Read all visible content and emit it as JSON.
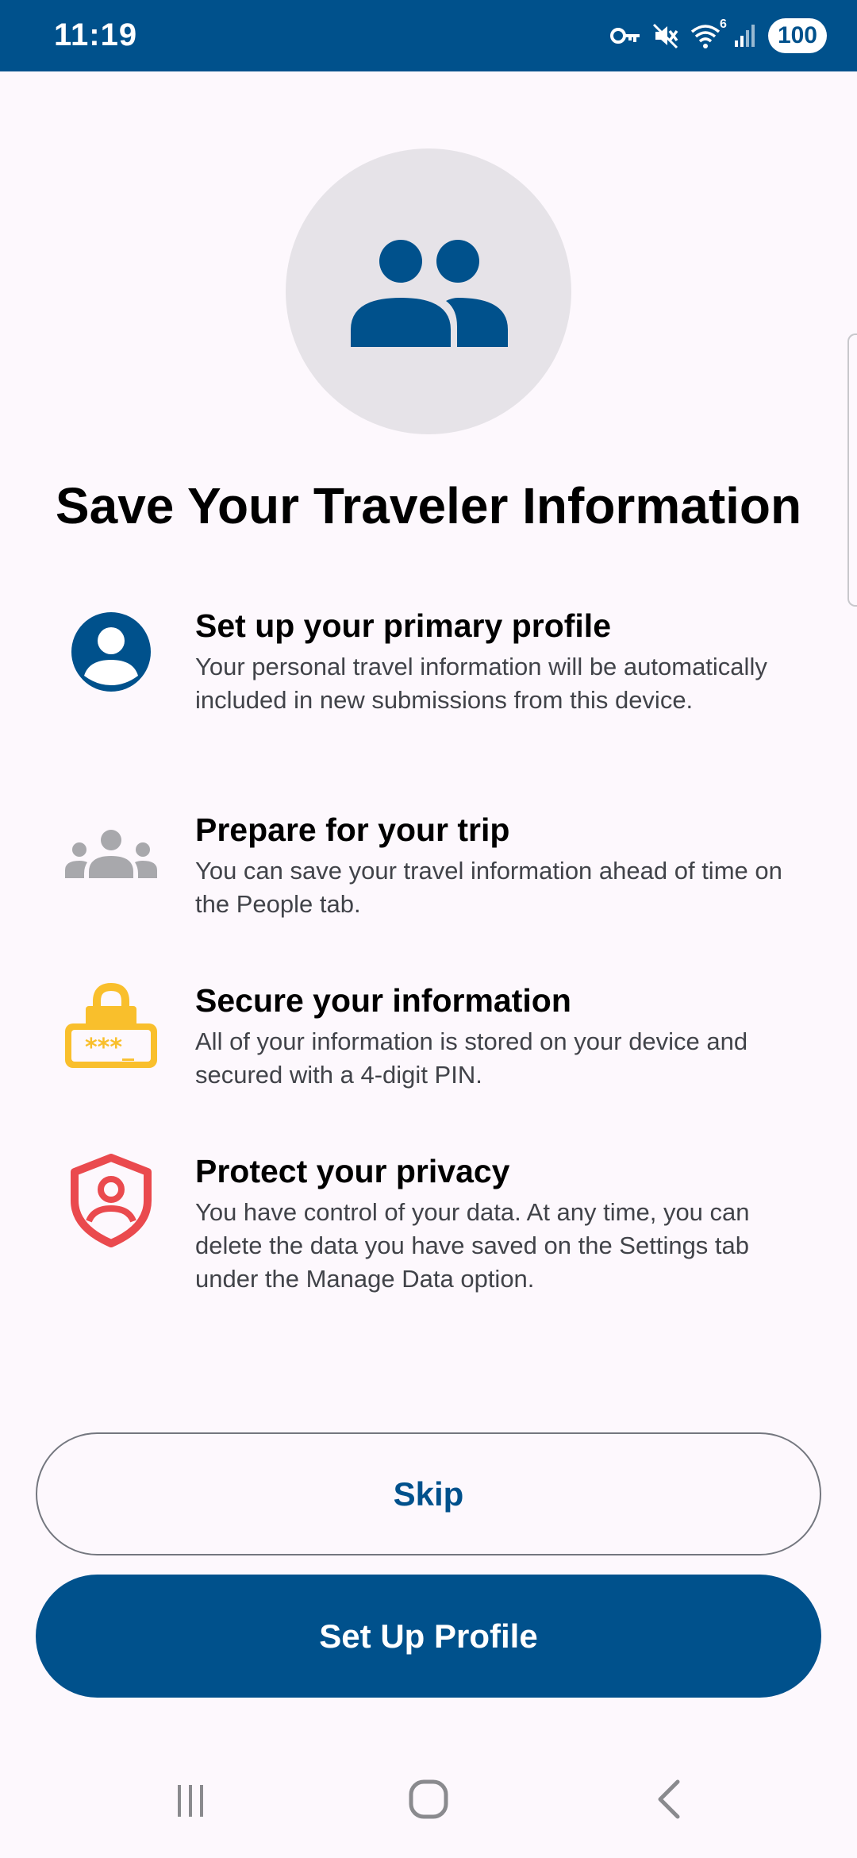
{
  "status_bar": {
    "time": "11:19",
    "icons": [
      "vpn-key-icon",
      "mute-icon",
      "wifi-icon",
      "signal-icon"
    ],
    "wifi_label": "6",
    "battery": "100"
  },
  "hero": {
    "icon": "people-group-icon"
  },
  "page_title": "Save Your Traveler Information",
  "features": [
    {
      "icon": "profile-icon",
      "title": "Set up your primary profile",
      "description": "Your personal travel information will be automatically included in new submissions from this device."
    },
    {
      "icon": "people-icon",
      "title": "Prepare for your trip",
      "description": "You can save your travel information ahead of time on the People tab."
    },
    {
      "icon": "lock-pin-icon",
      "title": "Secure your information",
      "description": "All of your information is stored on your device and secured with a 4-digit PIN.",
      "pin_text": "***_"
    },
    {
      "icon": "privacy-shield-icon",
      "title": "Protect your privacy",
      "description": "You have control of your data. At any time, you can delete the data you have saved on the Settings tab under the Manage Data option."
    }
  ],
  "buttons": {
    "skip_label": "Skip",
    "setup_label": "Set Up Profile"
  },
  "colors": {
    "brand": "#00518c",
    "background": "#fdf8fd",
    "circle": "#e6e3e8",
    "people_gray": "#a8a8ac",
    "lock_yellow": "#f9bf2c",
    "shield_red": "#ea4a4e"
  },
  "nav_bar": {
    "icons": [
      "recent-apps-icon",
      "home-icon",
      "back-icon"
    ]
  }
}
